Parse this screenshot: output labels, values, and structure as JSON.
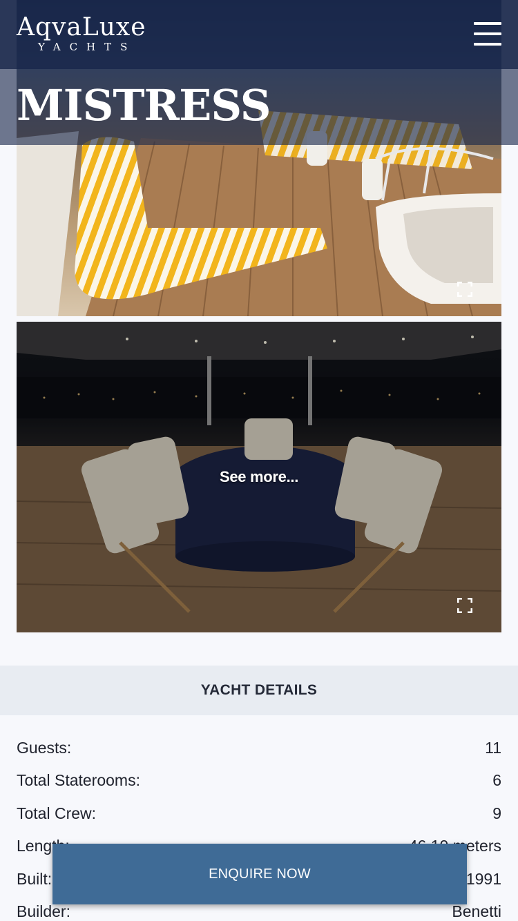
{
  "header": {
    "logo_main": "AqvaLuxe",
    "logo_sub": "YACHTS",
    "menu_icon": "hamburger-menu-icon",
    "yacht_name": "MISTRESS"
  },
  "gallery": {
    "see_more_label": "See more...",
    "expand_icon": "fullscreen-expand-icon"
  },
  "details": {
    "title": "YACHT DETAILS",
    "rows": [
      {
        "label": "Guests:",
        "value": "11"
      },
      {
        "label": "Total Staterooms:",
        "value": "6"
      },
      {
        "label": "Total Crew:",
        "value": "9"
      },
      {
        "label": "Length:",
        "value": "46.10 meters"
      },
      {
        "label": "Built:",
        "value": "1991"
      },
      {
        "label": "Builder:",
        "value": "Benetti"
      }
    ]
  },
  "cta": {
    "enquire_label": "ENQUIRE NOW"
  },
  "colors": {
    "header_bg": "#18264a",
    "button_bg": "#3f6b96",
    "details_header_bg": "#e8ecf2",
    "page_bg": "#f7f8fc"
  }
}
